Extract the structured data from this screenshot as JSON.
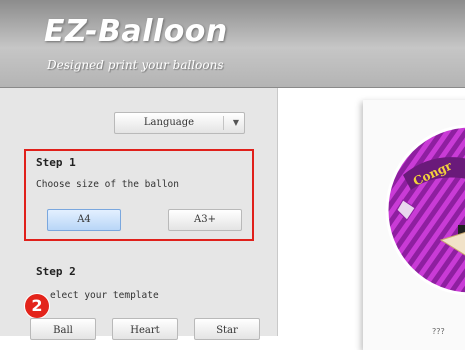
{
  "header": {
    "title": "EZ-Balloon",
    "subtitle": "Designed print your balloons"
  },
  "sidebar": {
    "language_button": "Language",
    "step1": {
      "title": "Step 1",
      "description": "Choose size of the ballon",
      "options": [
        "A4",
        "A3+"
      ],
      "selected": "A4"
    },
    "step2": {
      "title": "Step 2",
      "description": "elect your template",
      "templates": [
        "Ball",
        "Heart",
        "Star"
      ]
    },
    "callout_badge": "2"
  },
  "preview": {
    "balloon_text": "Congr",
    "caption": "??? "
  },
  "colors": {
    "highlight_border": "#e0201b",
    "badge": "#e3241b",
    "balloon_purple": "#b42ac1"
  }
}
